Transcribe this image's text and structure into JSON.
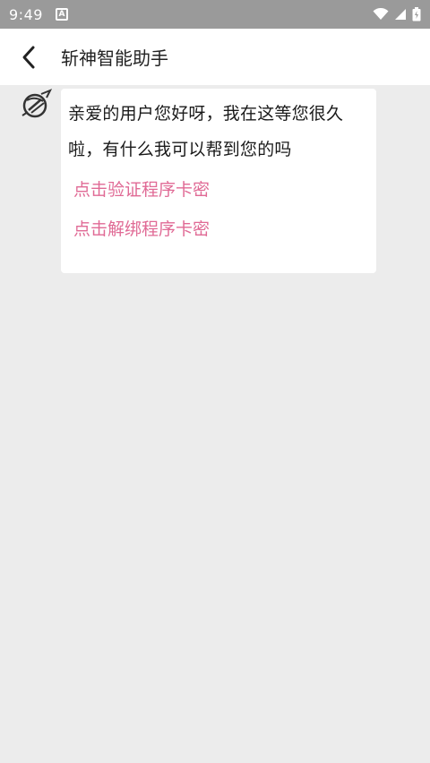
{
  "status_bar": {
    "time": "9:49",
    "notification_letter": "A",
    "icons": [
      "wifi-icon",
      "signal-icon",
      "battery-icon"
    ]
  },
  "app_bar": {
    "title": "斩神智能助手",
    "back_icon": "chevron-left-icon"
  },
  "chat": {
    "message": "亲爱的用户您好呀，我在这等您很久啦，有什么我可以帮到您的吗",
    "links": [
      {
        "label": "点击验证程序卡密"
      },
      {
        "label": "点击解绑程序卡密"
      }
    ]
  },
  "colors": {
    "status_bar": "#9a9a9a",
    "background": "#ececec",
    "link": "#e06a95"
  }
}
